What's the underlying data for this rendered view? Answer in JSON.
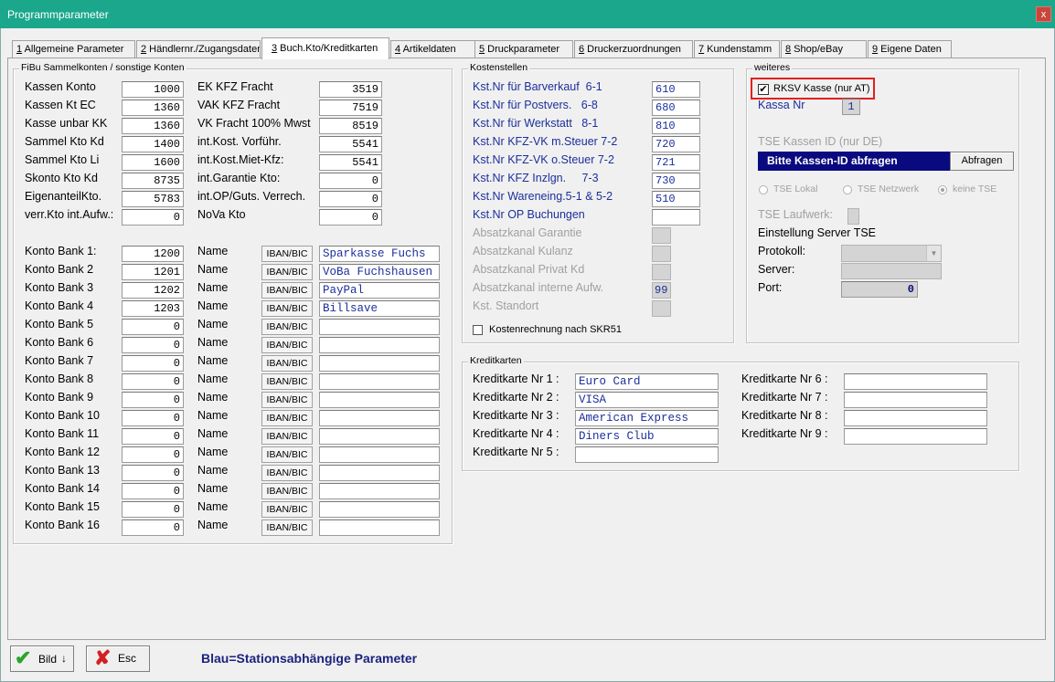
{
  "window": {
    "title": "Programmparameter",
    "close": "x"
  },
  "tabs": [
    {
      "num": "1",
      "label": " Allgemeine Parameter"
    },
    {
      "num": "2",
      "label": " Händlernr./Zugangsdaten"
    },
    {
      "num": "3",
      "label": " Buch.Kto/Kreditkarten"
    },
    {
      "num": "4",
      "label": " Artikeldaten"
    },
    {
      "num": "5",
      "label": " Druckparameter"
    },
    {
      "num": "6",
      "label": " Druckerzuordnungen"
    },
    {
      "num": "7",
      "label": " Kundenstamm"
    },
    {
      "num": "8",
      "label": " Shop/eBay"
    },
    {
      "num": "9",
      "label": " Eigene Daten"
    }
  ],
  "fibu": {
    "title": "FiBu Sammelkonten / sonstige Konten",
    "left": [
      {
        "label": "Kassen Konto",
        "value": "1000"
      },
      {
        "label": "Kassen Kt EC",
        "value": "1360"
      },
      {
        "label": "Kasse unbar KK",
        "value": "1360"
      },
      {
        "label": "Sammel Kto Kd",
        "value": "1400"
      },
      {
        "label": "Sammel Kto Li",
        "value": "1600"
      },
      {
        "label": "Skonto Kto Kd",
        "value": "8735"
      },
      {
        "label": "EigenanteilKto.",
        "value": "5783"
      },
      {
        "label": "verr.Kto int.Aufw.:",
        "value": "0"
      }
    ],
    "right": [
      {
        "label": "EK KFZ Fracht",
        "value": "3519"
      },
      {
        "label": "VAK KFZ Fracht",
        "value": "7519"
      },
      {
        "label": "VK Fracht 100% Mwst",
        "value": "8519"
      },
      {
        "label": "int.Kost. Vorführ.",
        "value": "5541"
      },
      {
        "label": "int.Kost.Miet-Kfz:",
        "value": "5541"
      },
      {
        "label": "int.Garantie Kto:",
        "value": "0"
      },
      {
        "label": "int.OP/Guts. Verrech.",
        "value": "0"
      },
      {
        "label": "NoVa Kto",
        "value": "0"
      }
    ],
    "banks": [
      {
        "label": "Konto Bank 1:",
        "value": "1200",
        "name_label": "Name",
        "iban": "IBAN/BIC",
        "name": "Sparkasse Fuchs"
      },
      {
        "label": "Konto Bank 2",
        "value": "1201",
        "name_label": "Name",
        "iban": "IBAN/BIC",
        "name": "VoBa Fuchshausen"
      },
      {
        "label": "Konto Bank 3",
        "value": "1202",
        "name_label": "Name",
        "iban": "IBAN/BIC",
        "name": "PayPal"
      },
      {
        "label": "Konto Bank 4",
        "value": "1203",
        "name_label": "Name",
        "iban": "IBAN/BIC",
        "name": "Billsave"
      },
      {
        "label": "Konto Bank 5",
        "value": "0",
        "name_label": "Name",
        "iban": "IBAN/BIC",
        "name": ""
      },
      {
        "label": "Konto Bank 6",
        "value": "0",
        "name_label": "Name",
        "iban": "IBAN/BIC",
        "name": ""
      },
      {
        "label": "Konto Bank 7",
        "value": "0",
        "name_label": "Name",
        "iban": "IBAN/BIC",
        "name": ""
      },
      {
        "label": "Konto Bank 8",
        "value": "0",
        "name_label": "Name",
        "iban": "IBAN/BIC",
        "name": ""
      },
      {
        "label": "Konto Bank 9",
        "value": "0",
        "name_label": "Name",
        "iban": "IBAN/BIC",
        "name": ""
      },
      {
        "label": "Konto Bank 10",
        "value": "0",
        "name_label": "Name",
        "iban": "IBAN/BIC",
        "name": ""
      },
      {
        "label": "Konto Bank 11",
        "value": "0",
        "name_label": "Name",
        "iban": "IBAN/BIC",
        "name": ""
      },
      {
        "label": "Konto Bank 12",
        "value": "0",
        "name_label": "Name",
        "iban": "IBAN/BIC",
        "name": ""
      },
      {
        "label": "Konto Bank 13",
        "value": "0",
        "name_label": "Name",
        "iban": "IBAN/BIC",
        "name": ""
      },
      {
        "label": "Konto Bank 14",
        "value": "0",
        "name_label": "Name",
        "iban": "IBAN/BIC",
        "name": ""
      },
      {
        "label": "Konto Bank 15",
        "value": "0",
        "name_label": "Name",
        "iban": "IBAN/BIC",
        "name": ""
      },
      {
        "label": "Konto Bank 16",
        "value": "0",
        "name_label": "Name",
        "iban": "IBAN/BIC",
        "name": ""
      }
    ]
  },
  "kosten": {
    "title": "Kostenstellen",
    "rows": [
      {
        "label": "Kst.Nr für Barverkauf  6-1",
        "value": "610",
        "style": "blue"
      },
      {
        "label": "Kst.Nr für Postvers.   6-8",
        "value": "680",
        "style": "blue"
      },
      {
        "label": "Kst.Nr für Werkstatt   8-1",
        "value": "810",
        "style": "blue"
      },
      {
        "label": "Kst.Nr KFZ-VK m.Steuer 7-2",
        "value": "720",
        "style": "blue"
      },
      {
        "label": "Kst.Nr KFZ-VK o.Steuer 7-2",
        "value": "721",
        "style": "blue"
      },
      {
        "label": "Kst.Nr KFZ Inzlgn.     7-3",
        "value": "730",
        "style": "blue"
      },
      {
        "label": "Kst.Nr Wareneing.5-1 & 5-2",
        "value": "510",
        "style": "blue"
      },
      {
        "label": "Kst.Nr OP Buchungen",
        "value": "",
        "style": "blue"
      },
      {
        "label": "Absatzkanal Garantie",
        "value": "",
        "style": "gray"
      },
      {
        "label": "Absatzkanal Kulanz",
        "value": "",
        "style": "gray"
      },
      {
        "label": "Absatzkanal Privat Kd",
        "value": "",
        "style": "gray"
      },
      {
        "label": "Absatzkanal interne Aufw.",
        "value": "99",
        "style": "gray"
      },
      {
        "label": "Kst. Standort",
        "value": "",
        "style": "gray"
      }
    ],
    "checkbox_label": "Kostenrechnung nach SKR51"
  },
  "weiteres": {
    "title": "weiteres",
    "rksv_label": "RKSV Kasse (nur AT)",
    "rksv_check": "✔",
    "kassa_label": "Kassa Nr",
    "kassa_value": "1",
    "tse_id_label": "TSE Kassen ID (nur DE)",
    "tse_id_value": "Bitte Kassen-ID abfragen",
    "abfragen": "Abfragen",
    "radios": [
      "TSE Lokal",
      "TSE Netzwerk",
      "keine TSE"
    ],
    "laufwerk_label": "TSE Laufwerk:",
    "server_setting": "Einstellung Server TSE",
    "protokoll_label": "Protokoll:",
    "server_label": "Server:",
    "port_label": "Port:",
    "port_value": "0"
  },
  "kredit": {
    "title": "Kreditkarten",
    "left": [
      {
        "label": "Kreditkarte Nr 1 :",
        "value": "Euro Card"
      },
      {
        "label": "Kreditkarte Nr 2 :",
        "value": "VISA"
      },
      {
        "label": "Kreditkarte Nr 3 :",
        "value": "American Express"
      },
      {
        "label": "Kreditkarte Nr 4 :",
        "value": "Diners Club"
      },
      {
        "label": "Kreditkarte Nr 5 :",
        "value": ""
      }
    ],
    "right": [
      {
        "label": "Kreditkarte Nr 6 :",
        "value": ""
      },
      {
        "label": "Kreditkarte Nr 7 :",
        "value": ""
      },
      {
        "label": "Kreditkarte Nr 8 :",
        "value": ""
      },
      {
        "label": "Kreditkarte Nr 9 :",
        "value": ""
      }
    ]
  },
  "footer": {
    "bild": "Bild",
    "bild_arrow": "↓",
    "esc": "Esc",
    "hint": "Blau=Stationsabhängige Parameter"
  },
  "colors": {
    "titlebar": "#1ba78c",
    "blue_text": "#1c2f9c",
    "tse_bar": "#0a0a80",
    "highlight": "#e02020"
  }
}
